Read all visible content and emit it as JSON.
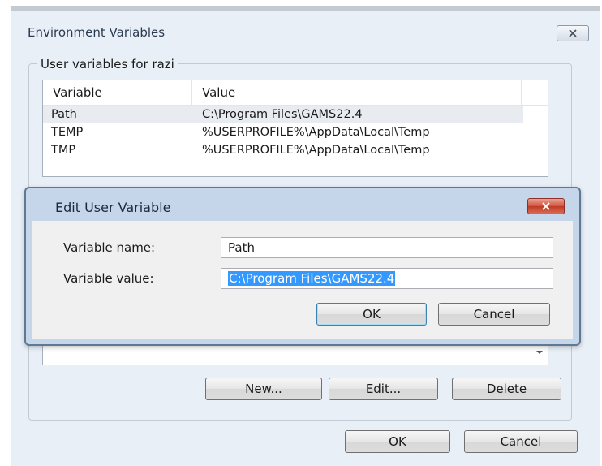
{
  "outer": {
    "title": "Environment Variables",
    "group_label": "User variables for razi",
    "columns": [
      "Variable",
      "Value"
    ],
    "rows": [
      {
        "variable": "Path",
        "value": "C:\\Program Files\\GAMS22.4"
      },
      {
        "variable": "TEMP",
        "value": "%USERPROFILE%\\AppData\\Local\\Temp"
      },
      {
        "variable": "TMP",
        "value": "%USERPROFILE%\\AppData\\Local\\Temp"
      }
    ],
    "buttons": {
      "new": "New...",
      "edit": "Edit...",
      "delete": "Delete"
    },
    "ok": "OK",
    "cancel": "Cancel",
    "close_icon": "close-icon"
  },
  "dialog": {
    "title": "Edit User Variable",
    "name_label": "Variable name:",
    "name_value": "Path",
    "value_label": "Variable value:",
    "value_value": "C:\\Program Files\\GAMS22.4",
    "ok": "OK",
    "cancel": "Cancel",
    "close_icon": "close-icon"
  },
  "colors": {
    "window_bg": "#e9eff7",
    "dialog_frame": "#c5d6ea",
    "selection": "#3399ff",
    "close_red": "#c03a23"
  }
}
